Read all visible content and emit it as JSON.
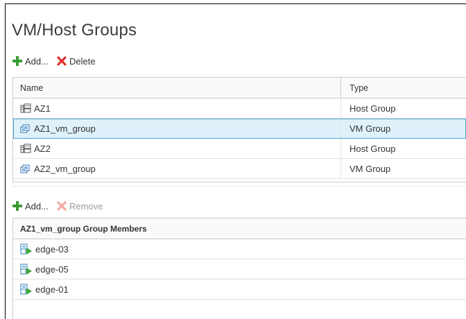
{
  "page": {
    "title": "VM/Host Groups"
  },
  "groups_toolbar": {
    "add_label": "Add...",
    "delete_label": "Delete"
  },
  "groups_table": {
    "columns": {
      "name": "Name",
      "type": "Type"
    },
    "rows": [
      {
        "name": "AZ1",
        "type": "Host Group",
        "icon": "host-group-icon",
        "selected": false
      },
      {
        "name": "AZ1_vm_group",
        "type": "VM Group",
        "icon": "vm-group-icon",
        "selected": true
      },
      {
        "name": "AZ2",
        "type": "Host Group",
        "icon": "host-group-icon",
        "selected": false
      },
      {
        "name": "AZ2_vm_group",
        "type": "VM Group",
        "icon": "vm-group-icon",
        "selected": false
      }
    ]
  },
  "members_toolbar": {
    "add_label": "Add...",
    "remove_label": "Remove"
  },
  "members_table": {
    "header": "AZ1_vm_group Group Members",
    "rows": [
      {
        "name": "edge-03",
        "icon": "vm-powered-on-icon"
      },
      {
        "name": "edge-05",
        "icon": "vm-powered-on-icon"
      },
      {
        "name": "edge-01",
        "icon": "vm-powered-on-icon"
      }
    ]
  },
  "colors": {
    "add_green": "#3a9a32",
    "delete_red": "#e0352b",
    "selection_bg": "#dff1fa",
    "selection_border": "#4aa3d6"
  }
}
